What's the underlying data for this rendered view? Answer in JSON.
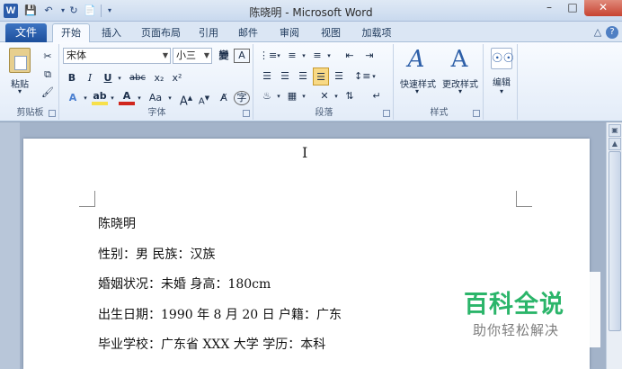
{
  "window": {
    "title": "陈晓明 - Microsoft Word",
    "app_icon_letter": "W",
    "qat": [
      "save-icon",
      "undo-icon",
      "redo-icon",
      "new-doc-icon"
    ]
  },
  "tabs": {
    "file": "文件",
    "items": [
      "开始",
      "插入",
      "页面布局",
      "引用",
      "邮件",
      "审阅",
      "视图",
      "加载项"
    ],
    "active": "开始"
  },
  "ribbon": {
    "clipboard": {
      "paste": "粘贴",
      "label": "剪贴板"
    },
    "font": {
      "font_name": "宋体",
      "font_size": "小三",
      "label": "字体",
      "buttons": [
        "B",
        "I",
        "U",
        "abc",
        "x₂",
        "x²",
        "A",
        "A",
        "Aa",
        "A",
        "A",
        "Ａ",
        "字"
      ]
    },
    "paragraph": {
      "label": "段落"
    },
    "styles": {
      "quick": "快速样式",
      "change": "更改样式",
      "label": "样式"
    },
    "editing": {
      "label": "编辑"
    }
  },
  "document": {
    "lines": [
      "陈晓明",
      "性别：男  民族：汉族",
      "婚姻状况：未婚  身高：180cm",
      "出生日期：1990 年 8 月 20 日  户籍：广东",
      "毕业学校：广东省 XXX 大学  学历：本科"
    ]
  },
  "watermark": {
    "main": "百科全说",
    "sub": "助你轻松解决"
  },
  "colors": {
    "accent": "#2a5caa",
    "watermark_green": "#2bb56a",
    "highlight": "#f7e04b",
    "font_red": "#d0261d"
  }
}
